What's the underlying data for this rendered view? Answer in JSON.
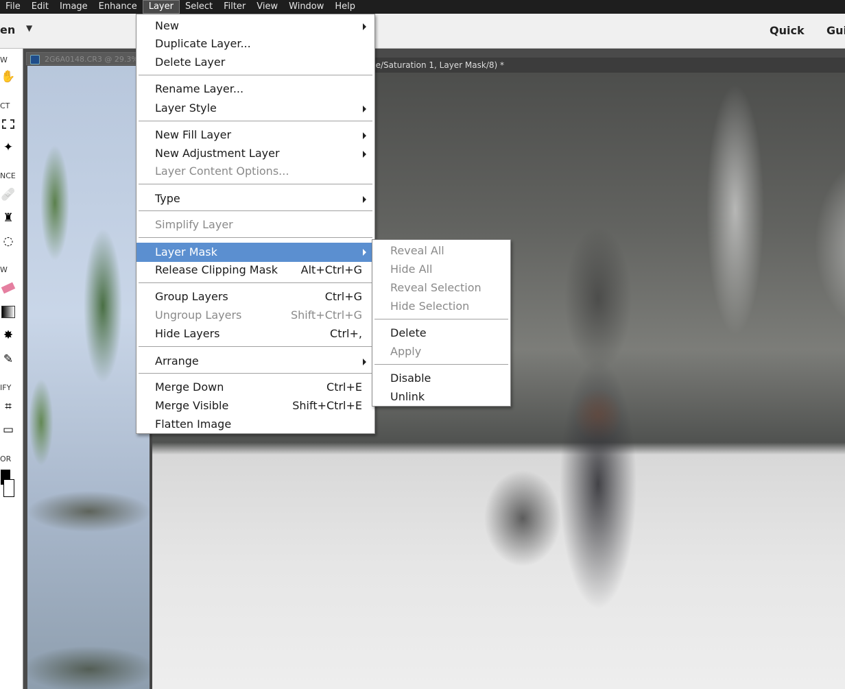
{
  "menubar": {
    "items": [
      "File",
      "Edit",
      "Image",
      "Enhance",
      "Layer",
      "Select",
      "Filter",
      "View",
      "Window",
      "Help"
    ],
    "active_index": 4
  },
  "topbar": {
    "mode": "en",
    "quick_tab": "Quick",
    "guided_tab": "Gui"
  },
  "toolbox": {
    "sections": [
      "W",
      "CT",
      "NCE",
      "W",
      "IFY",
      "OR"
    ],
    "tools": [
      "hand-icon",
      "marquee-icon",
      "magic-wand-icon",
      "healing-icon",
      "stamp-icon",
      "lasso-icon",
      "eraser-icon",
      "gradient-icon",
      "shape-icon",
      "pencil-icon",
      "crop-icon",
      "straighten-icon",
      "color-swatch-icon"
    ]
  },
  "documents": {
    "back_tab_title": "2G6A0148.CR3 @ 29.3%",
    "front_tab_title": "ue/Saturation 1, Layer Mask/8) *"
  },
  "layer_menu": {
    "items": [
      {
        "label": "New",
        "submenu": true
      },
      {
        "label": "Duplicate Layer...",
        "submenu": false
      },
      {
        "label": "Delete Layer",
        "submenu": false
      },
      {
        "label": "Rename Layer...",
        "submenu": false
      },
      {
        "label": "Layer Style",
        "submenu": true
      },
      {
        "label": "New Fill Layer",
        "submenu": true
      },
      {
        "label": "New Adjustment Layer",
        "submenu": true
      },
      {
        "label": "Layer Content Options...",
        "disabled": true
      },
      {
        "label": "Type",
        "submenu": true
      },
      {
        "label": "Simplify Layer",
        "disabled": true
      },
      {
        "label": "Layer Mask",
        "submenu": true,
        "highlighted": true
      },
      {
        "label": "Release Clipping Mask",
        "shortcut": "Alt+Ctrl+G"
      },
      {
        "label": "Group Layers",
        "shortcut": "Ctrl+G"
      },
      {
        "label": "Ungroup Layers",
        "shortcut": "Shift+Ctrl+G",
        "disabled": true
      },
      {
        "label": "Hide Layers",
        "shortcut": "Ctrl+,"
      },
      {
        "label": "Arrange",
        "submenu": true
      },
      {
        "label": "Merge Down",
        "shortcut": "Ctrl+E"
      },
      {
        "label": "Merge Visible",
        "shortcut": "Shift+Ctrl+E"
      },
      {
        "label": "Flatten Image"
      }
    ]
  },
  "layer_mask_submenu": {
    "items": [
      {
        "label": "Reveal All",
        "disabled": true
      },
      {
        "label": "Hide All",
        "disabled": true
      },
      {
        "label": "Reveal Selection",
        "disabled": true
      },
      {
        "label": "Hide Selection",
        "disabled": true
      },
      {
        "label": "Delete",
        "disabled": false
      },
      {
        "label": "Apply",
        "disabled": true
      },
      {
        "label": "Disable",
        "disabled": false
      },
      {
        "label": "Unlink",
        "disabled": false
      }
    ]
  },
  "colors": {
    "menubar_bg": "#1e1e1e",
    "highlight": "#5b8fd0",
    "disabled_text": "#8a8a8a"
  }
}
